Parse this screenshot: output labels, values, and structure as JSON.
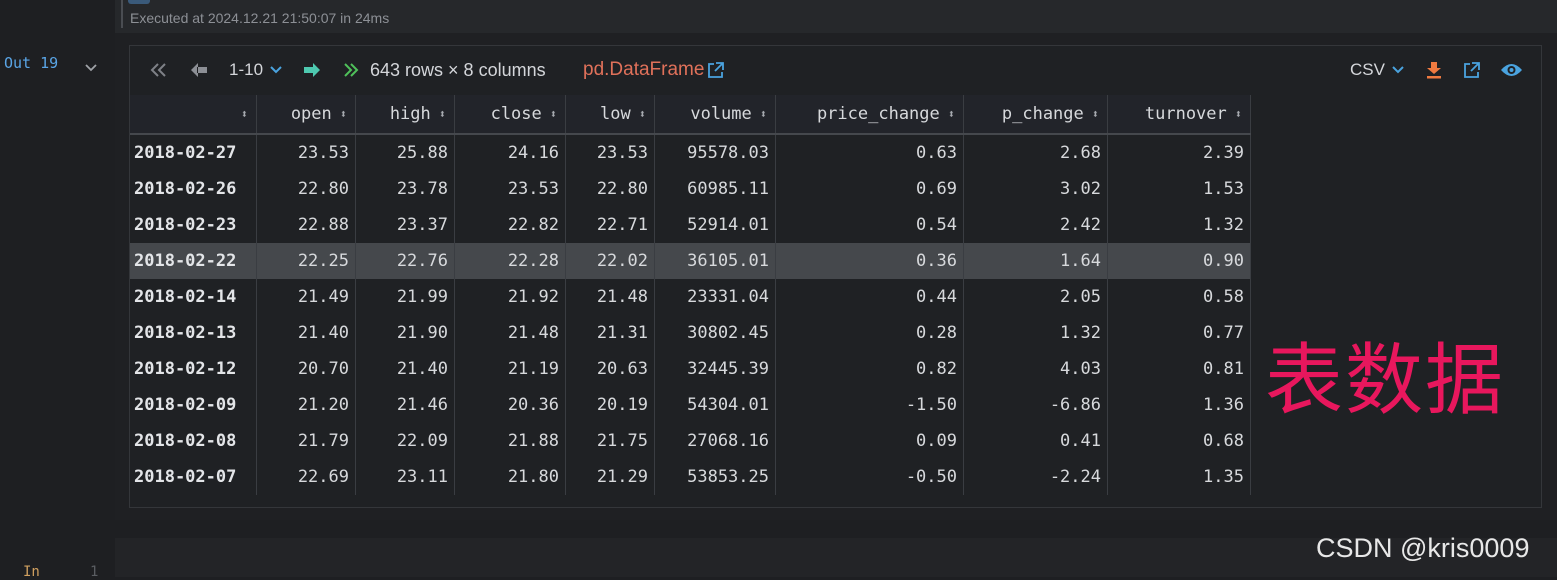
{
  "cell": {
    "exec_text": "Executed at 2024.12.21 21:50:07 in 24ms",
    "out_label": "Out 19",
    "in_label": "In",
    "in_number": "1"
  },
  "toolbar": {
    "page_range": "1-10",
    "summary": "643 rows × 8 columns",
    "type_link": "pd.DataFrame",
    "format": "CSV"
  },
  "table": {
    "columns": [
      "",
      "open",
      "high",
      "close",
      "low",
      "volume",
      "price_change",
      "p_change",
      "turnover"
    ],
    "rows": [
      [
        "2018-02-27",
        "23.53",
        "25.88",
        "24.16",
        "23.53",
        "95578.03",
        "0.63",
        "2.68",
        "2.39"
      ],
      [
        "2018-02-26",
        "22.80",
        "23.78",
        "23.53",
        "22.80",
        "60985.11",
        "0.69",
        "3.02",
        "1.53"
      ],
      [
        "2018-02-23",
        "22.88",
        "23.37",
        "22.82",
        "22.71",
        "52914.01",
        "0.54",
        "2.42",
        "1.32"
      ],
      [
        "2018-02-22",
        "22.25",
        "22.76",
        "22.28",
        "22.02",
        "36105.01",
        "0.36",
        "1.64",
        "0.90"
      ],
      [
        "2018-02-14",
        "21.49",
        "21.99",
        "21.92",
        "21.48",
        "23331.04",
        "0.44",
        "2.05",
        "0.58"
      ],
      [
        "2018-02-13",
        "21.40",
        "21.90",
        "21.48",
        "21.31",
        "30802.45",
        "0.28",
        "1.32",
        "0.77"
      ],
      [
        "2018-02-12",
        "20.70",
        "21.40",
        "21.19",
        "20.63",
        "32445.39",
        "0.82",
        "4.03",
        "0.81"
      ],
      [
        "2018-02-09",
        "21.20",
        "21.46",
        "20.36",
        "20.19",
        "54304.01",
        "-1.50",
        "-6.86",
        "1.36"
      ],
      [
        "2018-02-08",
        "21.79",
        "22.09",
        "21.88",
        "21.75",
        "27068.16",
        "0.09",
        "0.41",
        "0.68"
      ],
      [
        "2018-02-07",
        "22.69",
        "23.11",
        "21.80",
        "21.29",
        "53853.25",
        "-0.50",
        "-2.24",
        "1.35"
      ]
    ],
    "highlighted_row": 3
  },
  "annotation": {
    "text": "表数据"
  },
  "watermark": {
    "text": "CSDN @kris0009"
  },
  "colors": {
    "accent_link": "#e0715a",
    "icon_green": "#4ec9b0",
    "icon_blue": "#4aa3df",
    "annotation": "#e8175d"
  }
}
